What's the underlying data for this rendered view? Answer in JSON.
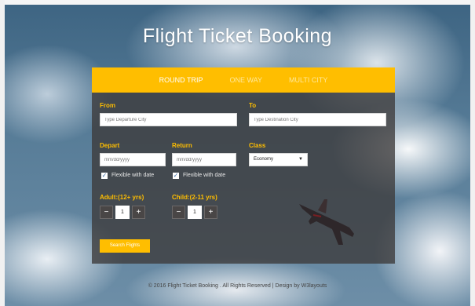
{
  "page": {
    "title": "Flight Ticket Booking",
    "footer": "© 2016 Flight Ticket Booking . All Rights Reserved | Design by W3layouts"
  },
  "colors": {
    "accent": "#ffbe00",
    "panel": "rgba(60,58,58,0.78)"
  },
  "tabs": [
    {
      "label": "ROUND TRIP",
      "active": true
    },
    {
      "label": "ONE WAY",
      "active": false
    },
    {
      "label": "MULTI CITY",
      "active": false
    }
  ],
  "form": {
    "from": {
      "label": "From",
      "placeholder": "Type Departure City"
    },
    "to": {
      "label": "To",
      "placeholder": "Type Destination City"
    },
    "depart": {
      "label": "Depart",
      "placeholder": "mm/dd/yyyy",
      "flexible_label": "Flexible with date",
      "flexible_checked": true
    },
    "return": {
      "label": "Return",
      "placeholder": "mm/dd/yyyy",
      "flexible_label": "Flexible with date",
      "flexible_checked": true
    },
    "class": {
      "label": "Class",
      "selected": "Economy",
      "icon": "caret-down-icon"
    },
    "adult": {
      "label": "Adult:(12+ yrs)",
      "value": "1",
      "minus": "−",
      "plus": "+"
    },
    "child": {
      "label": "Child:(2-11 yrs)",
      "value": "1",
      "minus": "−",
      "plus": "+"
    },
    "search_label": "Search Flights"
  }
}
